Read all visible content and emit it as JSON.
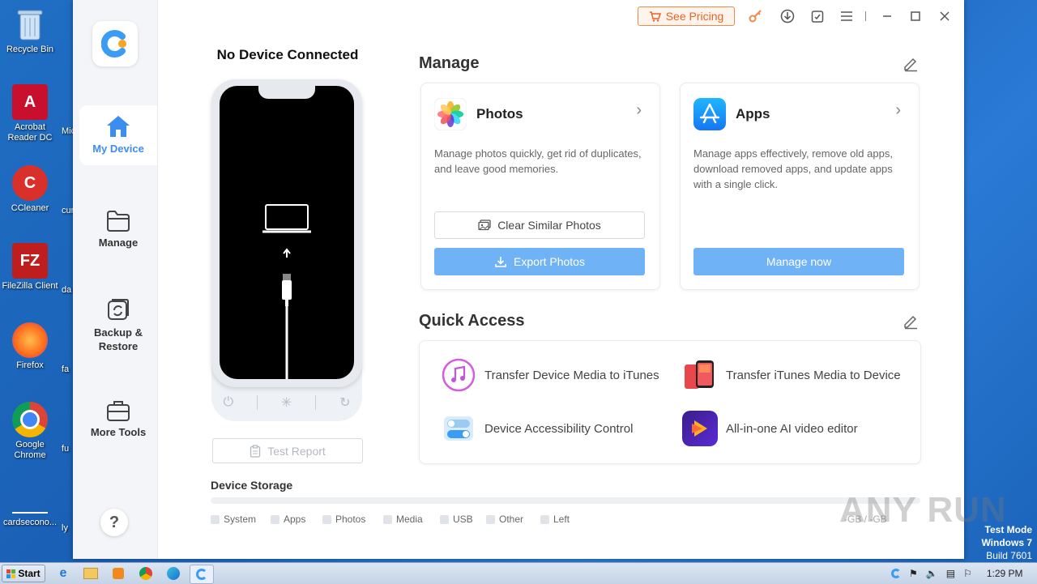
{
  "desktop": {
    "icons": [
      {
        "label": "Recycle Bin",
        "icon": "recycle-bin-icon"
      },
      {
        "label": "Acrobat Reader DC",
        "icon": "acrobat-icon"
      },
      {
        "label": "CCleaner",
        "icon": "ccleaner-icon"
      },
      {
        "label": "FileZilla Client",
        "icon": "filezilla-icon"
      },
      {
        "label": "Firefox",
        "icon": "firefox-icon"
      },
      {
        "label": "Google Chrome",
        "icon": "chrome-icon"
      },
      {
        "label": "cardsecono...",
        "icon": "file-icon"
      }
    ],
    "edge_labels": [
      "Mic",
      "cur",
      "da",
      "fa",
      "fu",
      "ly"
    ]
  },
  "titlebar": {
    "pricing_label": "See Pricing",
    "icons": [
      "key-icon",
      "download-icon",
      "feedback-icon",
      "menu-icon",
      "minimize-icon",
      "maximize-icon",
      "close-icon"
    ]
  },
  "sidebar": {
    "items": [
      {
        "label": "My Device",
        "icon": "home-icon",
        "active": true
      },
      {
        "label": "Manage",
        "icon": "folder-icon",
        "active": false
      },
      {
        "label": "Backup & Restore",
        "icon": "backup-icon",
        "active": false
      },
      {
        "label": "More Tools",
        "icon": "toolbox-icon",
        "active": false
      }
    ],
    "help_label": "?"
  },
  "device": {
    "title": "No Device Connected",
    "test_report_label": "Test Report"
  },
  "storage": {
    "title": "Device Storage",
    "legend": [
      "System",
      "Apps",
      "Photos",
      "Media",
      "USB",
      "Other",
      "Left"
    ],
    "size_text": "-GB / -GB"
  },
  "manage": {
    "title": "Manage",
    "photos": {
      "title": "Photos",
      "desc": "Manage photos quickly, get rid of duplicates, and leave good memories.",
      "btn_clear": "Clear Similar Photos",
      "btn_export": "Export Photos"
    },
    "apps": {
      "title": "Apps",
      "desc": "Manage apps effectively, remove old apps, download removed apps, and update apps with a single click.",
      "btn_manage": "Manage now"
    }
  },
  "quick_access": {
    "title": "Quick Access",
    "items": [
      {
        "label": "Transfer Device Media to iTunes",
        "icon": "itunes-icon"
      },
      {
        "label": "Transfer iTunes Media to Device",
        "icon": "phone-transfer-icon"
      },
      {
        "label": "Device Accessibility Control",
        "icon": "toggle-icon"
      },
      {
        "label": "All-in-one AI video editor",
        "icon": "video-editor-icon"
      }
    ]
  },
  "watermark": "ANY RUN",
  "system": {
    "test_mode_line1": "Test Mode",
    "test_mode_line2": "Windows 7",
    "test_mode_line3": "Build 7601",
    "start_label": "Start",
    "clock": "1:29 PM"
  },
  "colors": {
    "accent": "#3b8ef0",
    "button_blue": "#6fb2f6",
    "pricing_orange": "#e8622a"
  }
}
